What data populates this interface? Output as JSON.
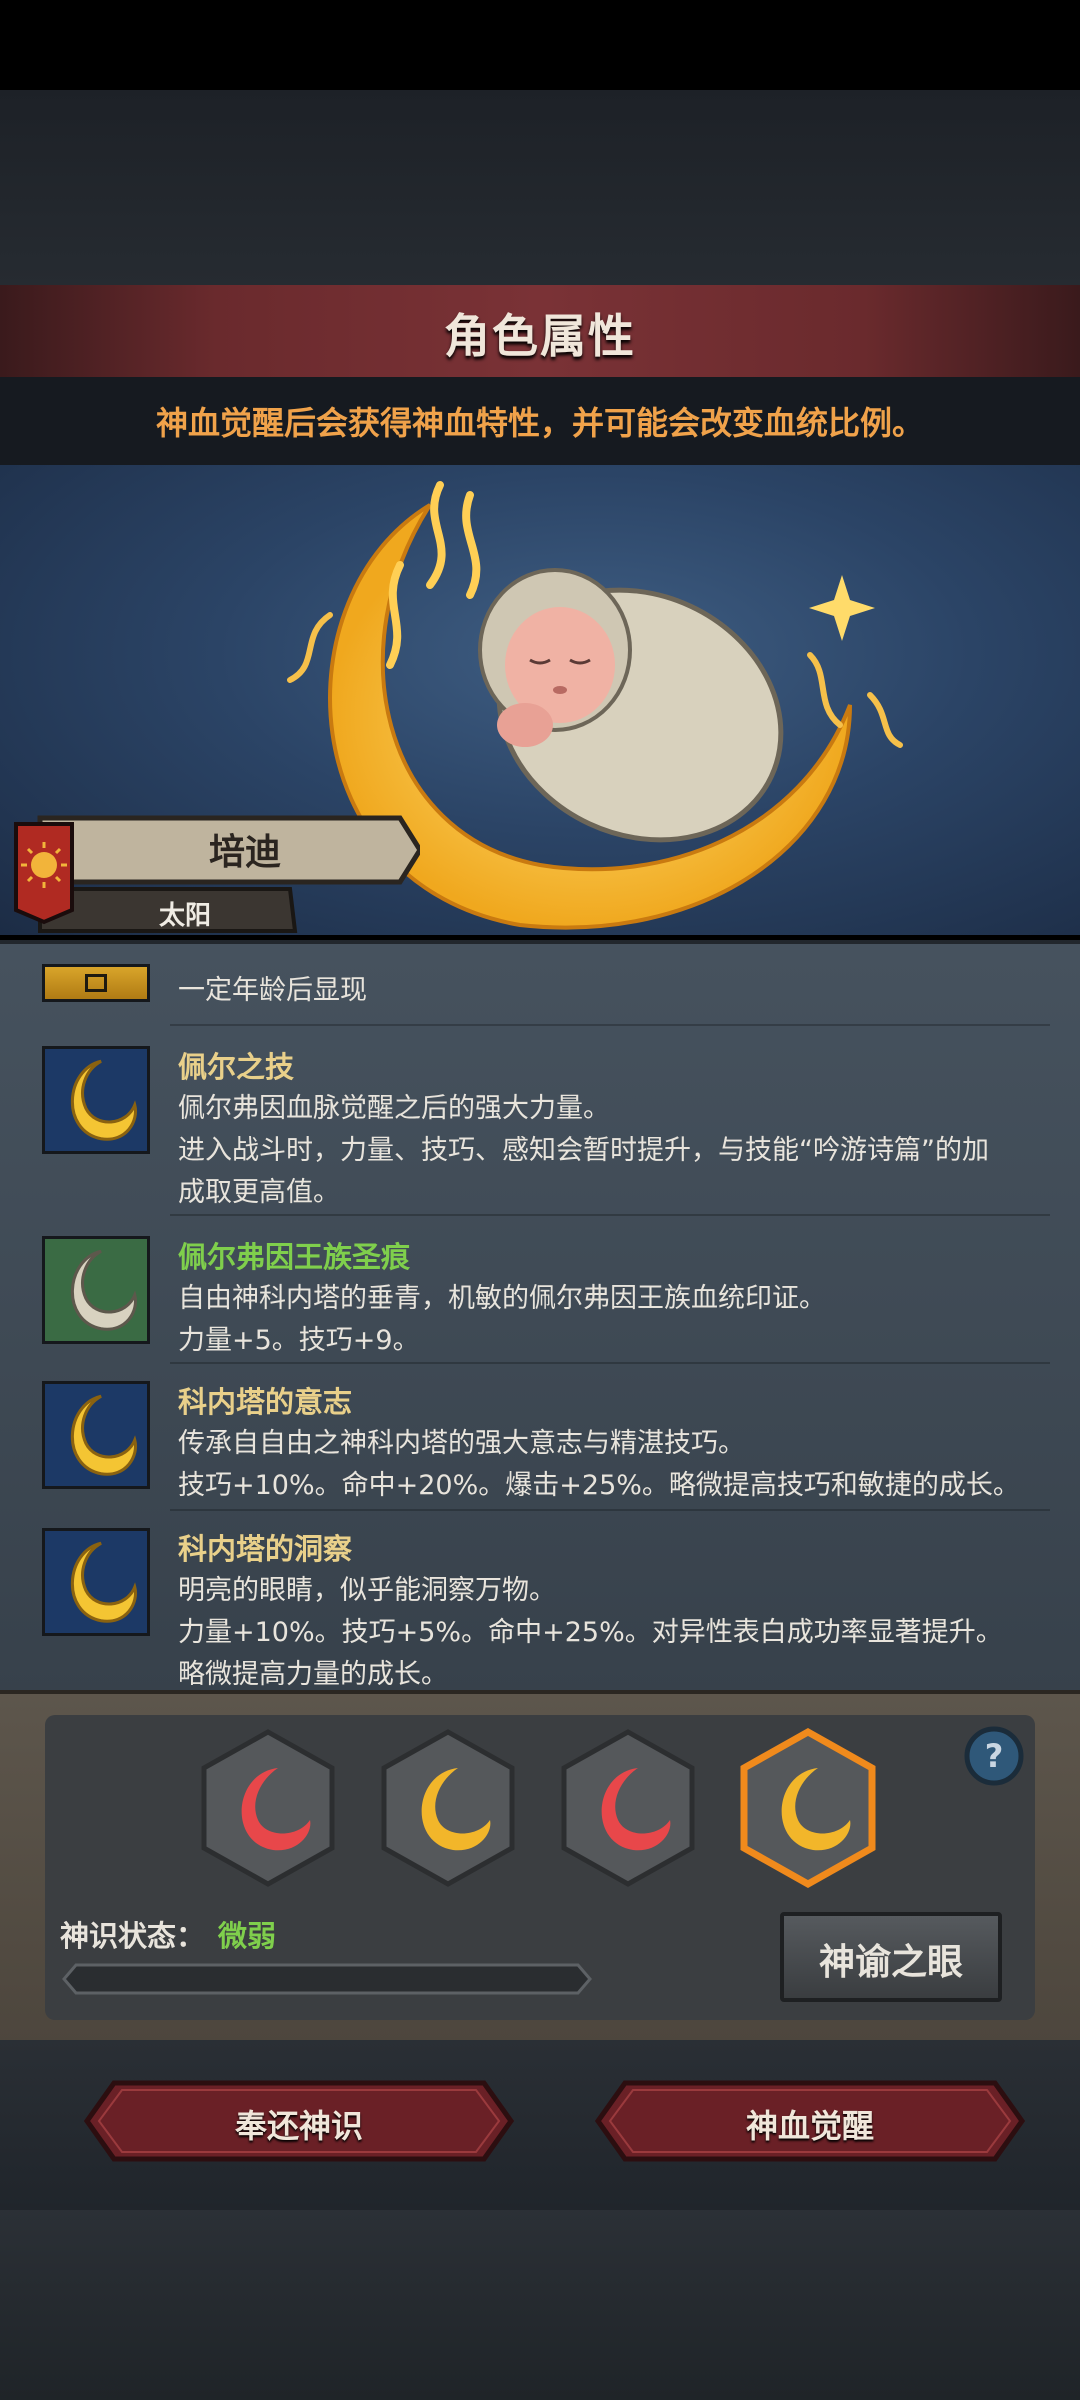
{
  "header": {
    "title": "角色属性",
    "notice": "神血觉醒后会获得神血特性，并可能会改变血统比例。"
  },
  "character": {
    "name": "培迪",
    "title": "太阳"
  },
  "traits_hidden": {
    "text": "一定年龄后显现"
  },
  "traits": [
    {
      "icon": "golden-crescent-icon",
      "name": "佩尔之技",
      "name_color": "#e9d08a",
      "lines": [
        "佩尔弗因血脉觉醒之后的强大力量。",
        "进入战斗时，力量、技巧、感知会暂时提升，与技能“吟游诗篇”的加",
        "成取更高值。"
      ]
    },
    {
      "icon": "silver-crescent-icon",
      "name": "佩尔弗因王族圣痕",
      "name_color": "#7fcf4c",
      "lines": [
        "自由神科内塔的垂青，机敏的佩尔弗因王族血统印证。",
        "力量+5。技巧+9。"
      ]
    },
    {
      "icon": "golden-crescent-icon",
      "name": "科内塔的意志",
      "name_color": "#e9d08a",
      "lines": [
        "传承自自由之神科内塔的强大意志与精湛技巧。",
        "技巧+10%。命中+20%。爆击+25%。略微提高技巧和敏捷的成长。"
      ]
    },
    {
      "icon": "golden-crescent-icon",
      "name": "科内塔的洞察",
      "name_color": "#e9d08a",
      "lines": [
        "明亮的眼睛，似乎能洞察万物。",
        "力量+10%。技巧+5%。命中+25%。对异性表白成功率显著提升。",
        "略微提高力量的成长。"
      ]
    }
  ],
  "awakening": {
    "slots": [
      {
        "icon": "red-crescent-icon",
        "selected": false
      },
      {
        "icon": "gold-crescent-icon",
        "selected": false
      },
      {
        "icon": "red-crescent-icon",
        "selected": false
      },
      {
        "icon": "gold-crescent-icon",
        "selected": true
      }
    ],
    "status_label": "神识状态：",
    "status_value": "微弱",
    "progress": 0,
    "oracle_button": "神谕之眼"
  },
  "actions": {
    "return_label": "奉还神识",
    "awaken_label": "神血觉醒"
  }
}
